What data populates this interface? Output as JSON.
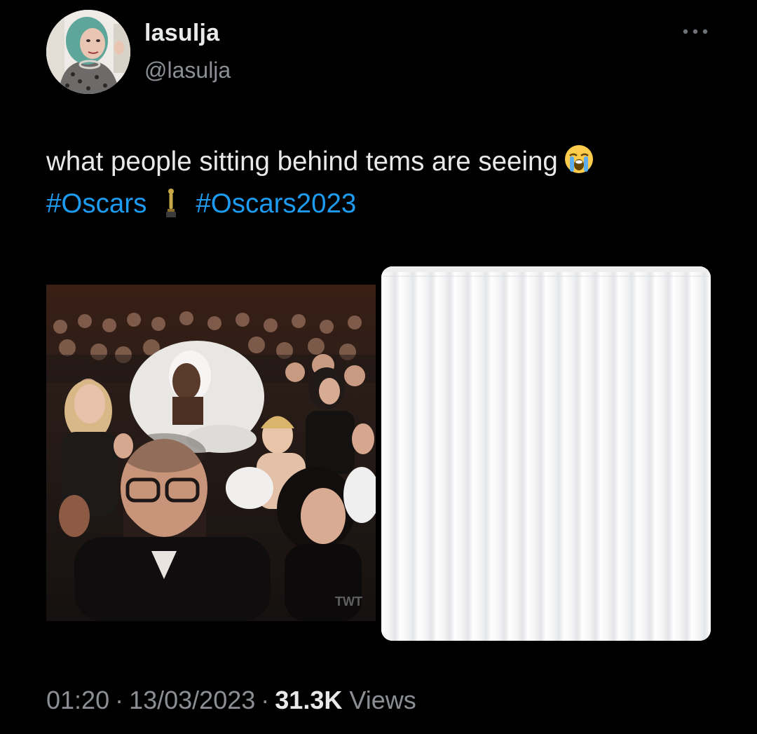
{
  "author": {
    "display_name": "lasulja",
    "handle": "@lasulja",
    "avatar_icon": "profile-photo-avatar"
  },
  "menu": {
    "more_icon": "more-dots-icon"
  },
  "tweet": {
    "text_line1": "what people sitting behind tems are seeing",
    "emoji_icon": "loudly-crying-face-emoji",
    "hashtag1": "#Oscars",
    "trophy_icon": "oscar-trophy-emoji",
    "hashtag2": "#Oscars2023"
  },
  "media": {
    "left_image": "audience-photo",
    "left_watermark": "TWT",
    "right_image": "white-curtain-photo"
  },
  "meta": {
    "time": "01:20",
    "separator": "·",
    "date": "13/03/2023",
    "views_count": "31.3K",
    "views_label": "Views"
  },
  "colors": {
    "background": "#000000",
    "text": "#e7e9ea",
    "secondary": "#8b8f94",
    "link": "#1d9bf0"
  }
}
